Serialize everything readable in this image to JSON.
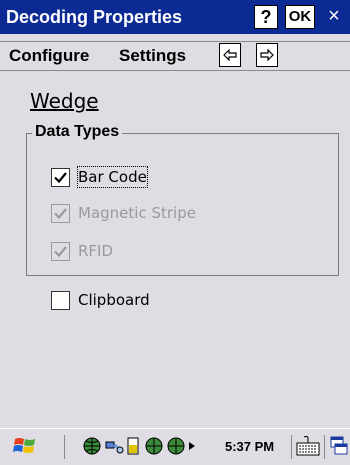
{
  "window": {
    "title": "Decoding Properties",
    "help_label": "?",
    "ok_label": "OK",
    "close_label": "×"
  },
  "menu": {
    "configure": "Configure",
    "settings": "Settings"
  },
  "wedge": {
    "label": "Wedge"
  },
  "data_types": {
    "legend": "Data Types",
    "options": [
      {
        "label": "Bar Code",
        "checked": true,
        "enabled": true
      },
      {
        "label": "Magnetic Stripe",
        "checked": true,
        "enabled": false
      },
      {
        "label": "RFID",
        "checked": true,
        "enabled": false
      }
    ]
  },
  "clipboard": {
    "label": "Clipboard",
    "checked": false
  },
  "taskbar": {
    "clock": "5:37 PM"
  }
}
